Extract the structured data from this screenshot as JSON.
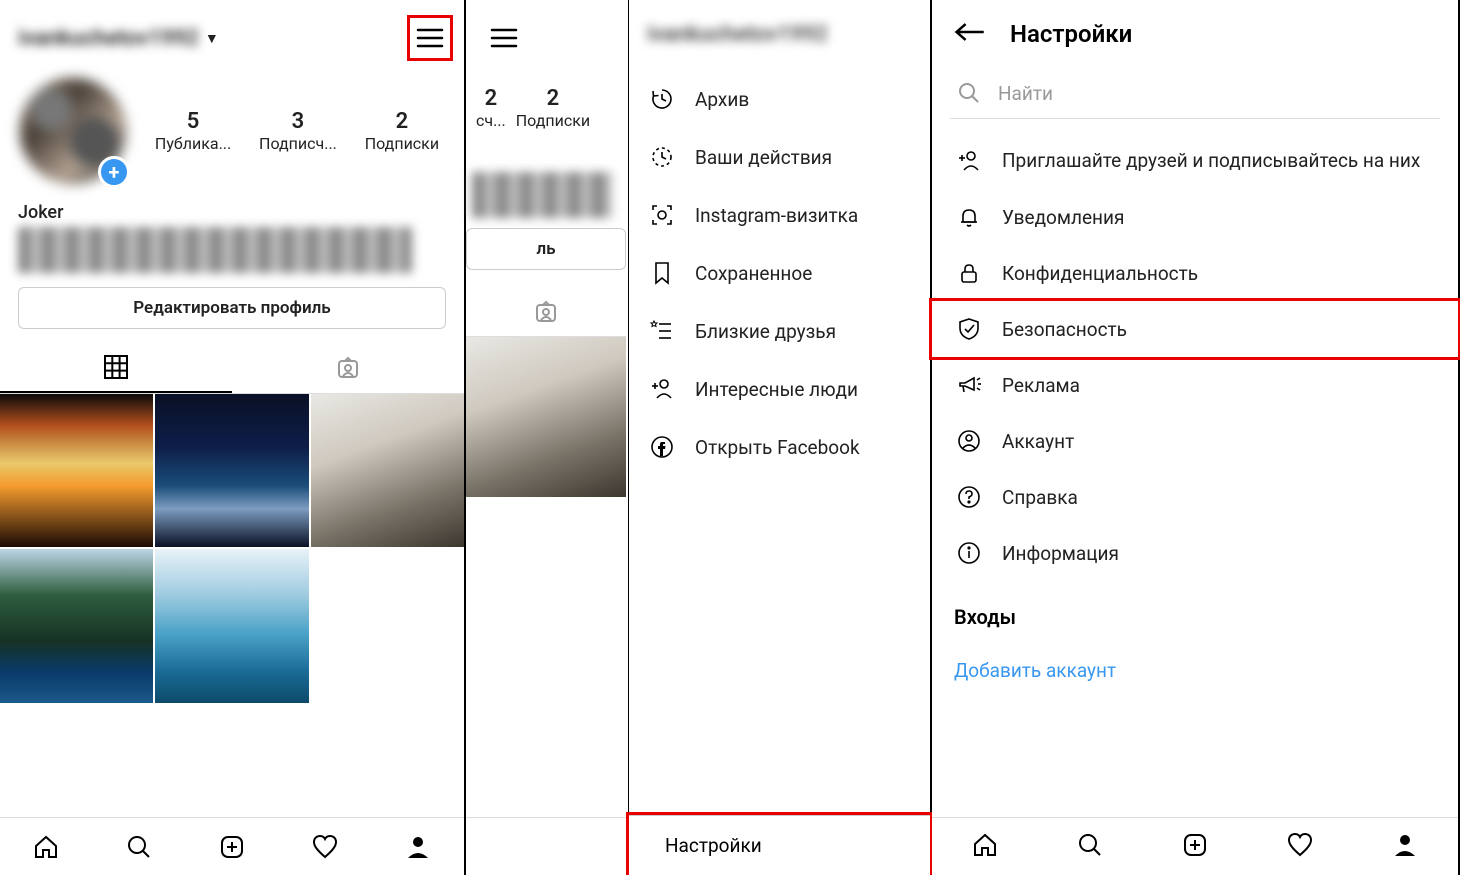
{
  "col1": {
    "username": "ivankuchetov1992",
    "stats": [
      {
        "num": "5",
        "label": "Публика..."
      },
      {
        "num": "3",
        "label": "Подписч..."
      },
      {
        "num": "2",
        "label": "Подписки"
      }
    ],
    "display_name": "Joker",
    "edit_profile": "Редактировать профиль"
  },
  "col2": {
    "username": "ivankuchetov1992",
    "stats_partial": [
      {
        "num": "2",
        "label": "сч..."
      },
      {
        "num": "2",
        "label": "Подписки"
      }
    ],
    "edit_partial": "ль",
    "side_menu": [
      {
        "id": "archive",
        "label": "Архив"
      },
      {
        "id": "activity",
        "label": "Ваши действия"
      },
      {
        "id": "nametag",
        "label": "Instagram-визитка"
      },
      {
        "id": "saved",
        "label": "Сохраненное"
      },
      {
        "id": "close-friends",
        "label": "Близкие друзья"
      },
      {
        "id": "discover",
        "label": "Интересные люди"
      },
      {
        "id": "facebook",
        "label": "Открыть Facebook"
      }
    ],
    "settings_label": "Настройки"
  },
  "col3": {
    "title": "Настройки",
    "search_placeholder": "Найти",
    "items": [
      {
        "id": "invite",
        "label": "Приглашайте друзей и подписывайтесь на них"
      },
      {
        "id": "notifications",
        "label": "Уведомления"
      },
      {
        "id": "privacy",
        "label": "Конфиденциальность"
      },
      {
        "id": "security",
        "label": "Безопасность"
      },
      {
        "id": "ads",
        "label": "Реклама"
      },
      {
        "id": "account",
        "label": "Аккаунт"
      },
      {
        "id": "help",
        "label": "Справка"
      },
      {
        "id": "about",
        "label": "Информация"
      }
    ],
    "logins_header": "Входы",
    "add_account": "Добавить аккаунт"
  }
}
